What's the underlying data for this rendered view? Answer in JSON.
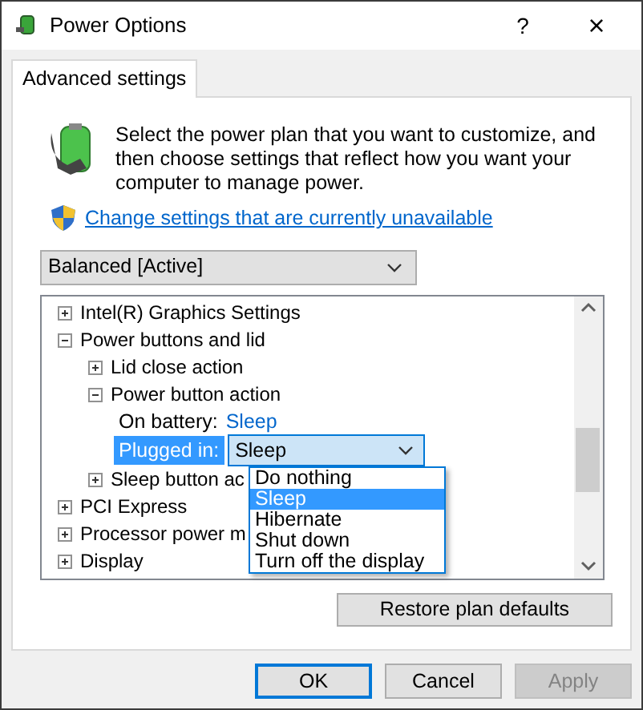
{
  "window": {
    "title": "Power Options",
    "help": "?",
    "close": "×"
  },
  "tabs": [
    {
      "label": "Advanced settings",
      "selected": true
    }
  ],
  "intro": {
    "text": "Select the power plan that you want to customize, and then choose settings that reflect how you want your computer to manage power.",
    "link": "Change settings that are currently unavailable"
  },
  "plan_select": {
    "value": "Balanced [Active]"
  },
  "tree": [
    {
      "kind": "group",
      "label": "Intel(R) Graphics Settings",
      "expanded": false
    },
    {
      "kind": "group",
      "label": "Power buttons and lid",
      "expanded": true,
      "children": [
        {
          "kind": "group",
          "label": "Lid close action",
          "expanded": false
        },
        {
          "kind": "group",
          "label": "Power button action",
          "expanded": true,
          "children": [
            {
              "kind": "value",
              "label": "On battery:",
              "value": "Sleep",
              "selected": false
            },
            {
              "kind": "combo",
              "label": "Plugged in:",
              "value": "Sleep",
              "selected": true
            }
          ]
        },
        {
          "kind": "group",
          "label": "Sleep button ac",
          "expanded": false
        }
      ]
    },
    {
      "kind": "group",
      "label": "PCI Express",
      "expanded": false
    },
    {
      "kind": "group",
      "label": "Processor power m",
      "expanded": false
    },
    {
      "kind": "group",
      "label": "Display",
      "expanded": false
    }
  ],
  "dropdown_options": [
    {
      "label": "Do nothing",
      "selected": false
    },
    {
      "label": "Sleep",
      "selected": true
    },
    {
      "label": "Hibernate",
      "selected": false
    },
    {
      "label": "Shut down",
      "selected": false
    },
    {
      "label": "Turn off the display",
      "selected": false
    }
  ],
  "restore_button": "Restore plan defaults",
  "buttons": [
    {
      "label": "OK",
      "default": true,
      "disabled": false
    },
    {
      "label": "Cancel",
      "default": false,
      "disabled": false
    },
    {
      "label": "Apply",
      "default": false,
      "disabled": true
    }
  ]
}
